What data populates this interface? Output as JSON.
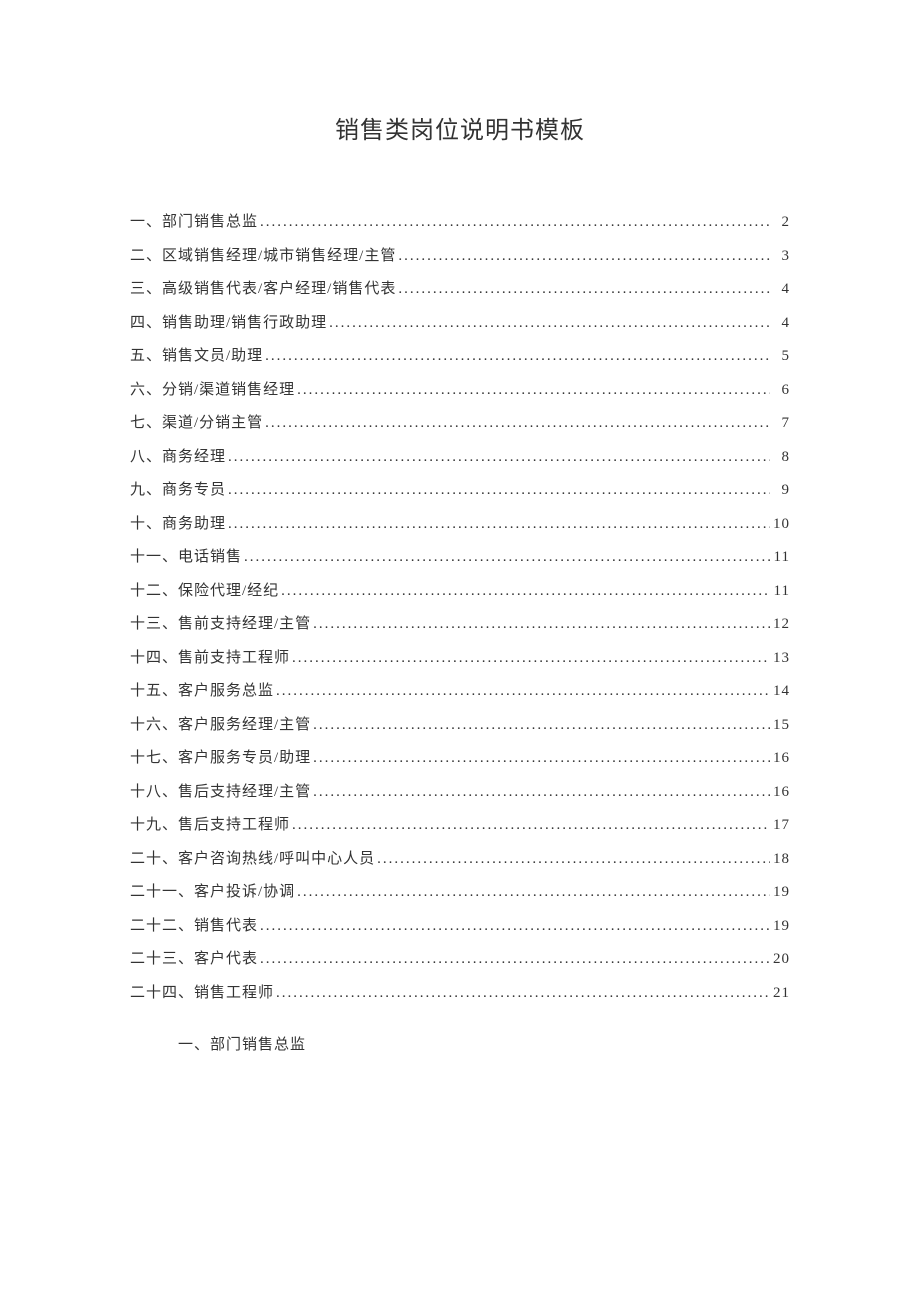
{
  "title": "销售类岗位说明书模板",
  "toc": [
    {
      "label": "一、部门销售总监",
      "page": "2"
    },
    {
      "label": "二、区域销售经理/城市销售经理/主管",
      "page": "3"
    },
    {
      "label": "三、高级销售代表/客户经理/销售代表",
      "page": "4"
    },
    {
      "label": "四、销售助理/销售行政助理",
      "page": "4"
    },
    {
      "label": "五、销售文员/助理",
      "page": "5"
    },
    {
      "label": "六、分销/渠道销售经理",
      "page": "6"
    },
    {
      "label": "七、渠道/分销主管",
      "page": "7"
    },
    {
      "label": "八、商务经理",
      "page": "8"
    },
    {
      "label": "九、商务专员",
      "page": "9"
    },
    {
      "label": "十、商务助理",
      "page": "10"
    },
    {
      "label": "十一、电话销售",
      "page": "11"
    },
    {
      "label": "十二、保险代理/经纪",
      "page": "11"
    },
    {
      "label": "十三、售前支持经理/主管",
      "page": "12"
    },
    {
      "label": "十四、售前支持工程师",
      "page": "13"
    },
    {
      "label": "十五、客户服务总监",
      "page": "14"
    },
    {
      "label": "十六、客户服务经理/主管",
      "page": "15"
    },
    {
      "label": "十七、客户服务专员/助理",
      "page": "16"
    },
    {
      "label": "十八、售后支持经理/主管",
      "page": "16"
    },
    {
      "label": "十九、售后支持工程师",
      "page": "17"
    },
    {
      "label": "二十、客户咨询热线/呼叫中心人员",
      "page": "18"
    },
    {
      "label": "二十一、客户投诉/协调",
      "page": "19"
    },
    {
      "label": "二十二、销售代表",
      "page": "19"
    },
    {
      "label": "二十三、客户代表",
      "page": "20"
    },
    {
      "label": "二十四、销售工程师",
      "page": "21"
    }
  ],
  "section_heading": "一、部门销售总监"
}
